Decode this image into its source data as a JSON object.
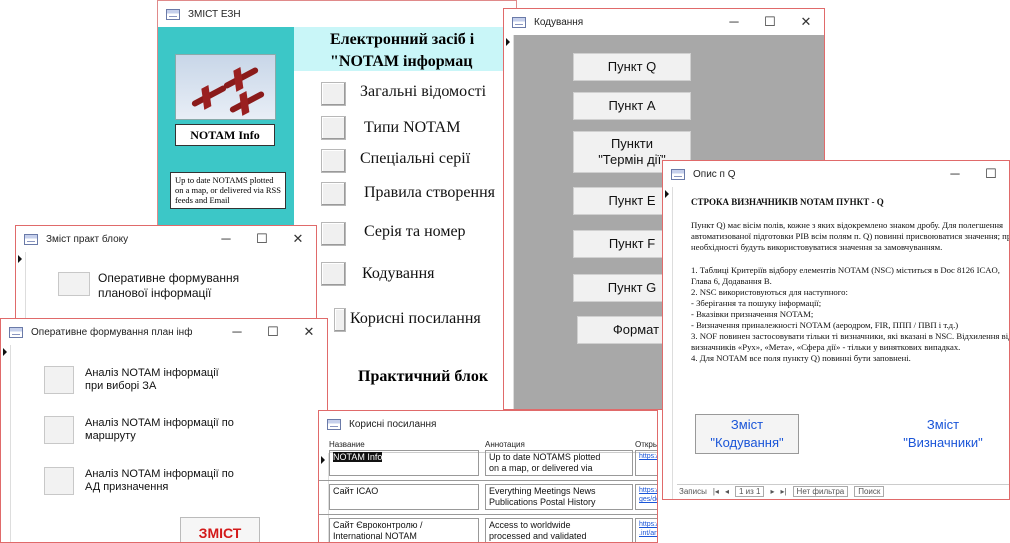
{
  "main": {
    "title": "ЗМІСТ ЕЗН",
    "header": "Електронний засіб і\n\"NOTAM інформац",
    "notam_label": "NOTAM Info",
    "description": "Up to date NOTAMS plotted on a map, or delivered via RSS feeds and Email",
    "menu": [
      "Загальні відомості",
      "Типи NOTAM",
      "Спеціальні серії",
      "Правила створення",
      "Серія та номер",
      "Кодування",
      "Корисні посилання"
    ],
    "section": "Практичний блок"
  },
  "kodyvannya": {
    "title": "Кодування",
    "buttons": [
      "Пункт Q",
      "Пункт А",
      "Пункти\n\"Термін дії\"",
      "Пункт E",
      "Пункт F",
      "Пункт G",
      "Формат"
    ]
  },
  "opis": {
    "title": "Опис п Q",
    "heading": "СТРОКА ВИЗНАЧНИКІВ NOTAM ПУНКТ - Q",
    "para1": "Пункт Q) має вісім полів, кожне з яких відокремлено знаком дробу. Для полегшення автоматизованої підготовки PIB всім полям п. Q) повинні присвоюватися значення; при необхідності будуть використовуватися значення за замовчуванням.",
    "items": [
      "1. Таблиці Критеріїв відбору елементів NOTAM (NSC) міститься в Doc 8126 ICAO, Глава 6, Додавання В.",
      "2. NSC використовуються для наступного:",
      "- Зберігання та пошуку інформації;",
      "- Вказівки призначення NOTAM;",
      "- Визначення приналежності NOTAM (аеродром, FIR, ППП / ПВП і т.д.)",
      "3. NOF повинен застосовувати тільки ті визначники, які вказані в NSC. Відхилення від визначників «Рух», «Мета», «Сфера дії» - тільки у винятк­ових випадках.",
      "4. Для NOTAM все поля пункту Q) повинні бути заповнені."
    ],
    "btn_left": "Зміст\n\"Кодування\"",
    "btn_right": "Зміст\n\"Визначники\"",
    "nav_records": "Записы",
    "nav_pos": "1 из 1",
    "nav_filter": "Нет фильтра",
    "nav_search": "Поиск"
  },
  "zmist_prakt": {
    "title": "Зміст практ блоку",
    "item": "Оперативне формування\nпланової інформації"
  },
  "oper": {
    "title": "Оперативне формування план інф",
    "items": [
      "Аналіз NOTAM інформації\nпри виборі ЗА",
      "Аналіз NOTAM інформації по\nмаршруту",
      "Аналіз NOTAM інформації по\nАД призначення"
    ],
    "zmist": "ЗМІСТ"
  },
  "koryсni": {
    "title": "Корисні посилання",
    "col_name": "Название",
    "col_ann": "Аннотация",
    "col_open": "Открыт",
    "rows": [
      {
        "name": "NOTAM Info",
        "ann": "Up to date NOTAMS plotted\non a map, or delivered via",
        "link": "https://"
      },
      {
        "name": "Сайт ICAO",
        "ann": "Everything Meetings News\nPublications Postal History",
        "link": "https://\nges/de..."
      },
      {
        "name": "Сайт Євроконтролю /\nInternational NOTAM",
        "ann": "Access to worldwide\nprocessed and validated",
        "link": "https://www.eurocontrol\n.int/articles/ino-"
      }
    ]
  },
  "colors": {
    "teal": "#3cc7c7",
    "light_teal": "#c9f6f8",
    "link_blue": "#1a55d8",
    "zmist_red": "#d31a1a"
  }
}
